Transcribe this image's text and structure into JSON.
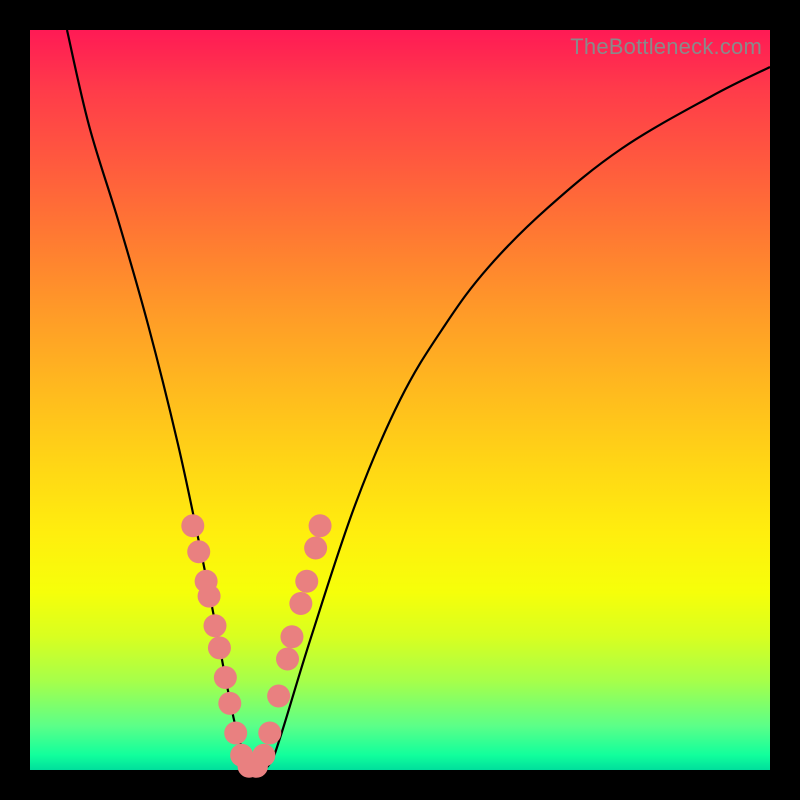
{
  "watermark": "TheBottleneck.com",
  "chart_data": {
    "type": "line",
    "title": "",
    "xlabel": "",
    "ylabel": "",
    "xlim": [
      0,
      100
    ],
    "ylim": [
      0,
      100
    ],
    "grid": false,
    "legend": false,
    "series": [
      {
        "name": "bottleneck-curve",
        "x": [
          5,
          8,
          12,
          16,
          20,
          23,
          25,
          26.5,
          28,
          29.5,
          31,
          32.5,
          34,
          38,
          44,
          50,
          56,
          62,
          70,
          80,
          92,
          100
        ],
        "y": [
          100,
          87,
          74,
          60,
          44,
          30,
          20,
          12,
          5,
          1,
          0,
          1,
          5,
          18,
          36,
          50,
          60,
          68,
          76,
          84,
          91,
          95
        ]
      }
    ],
    "markers": {
      "name": "overlay-points",
      "color": "#e98080",
      "x": [
        22.0,
        22.8,
        23.8,
        24.2,
        25.0,
        25.6,
        26.4,
        27.0,
        27.8,
        28.6,
        29.6,
        30.6,
        31.6,
        32.4,
        33.6,
        34.8,
        35.4,
        36.6,
        37.4,
        38.6,
        39.2
      ],
      "y": [
        33.0,
        29.5,
        25.5,
        23.5,
        19.5,
        16.5,
        12.5,
        9.0,
        5.0,
        2.0,
        0.5,
        0.5,
        2.0,
        5.0,
        10.0,
        15.0,
        18.0,
        22.5,
        25.5,
        30.0,
        33.0
      ]
    },
    "background_gradient": {
      "top": "#ff1a55",
      "bottom": "#00de9c"
    }
  }
}
